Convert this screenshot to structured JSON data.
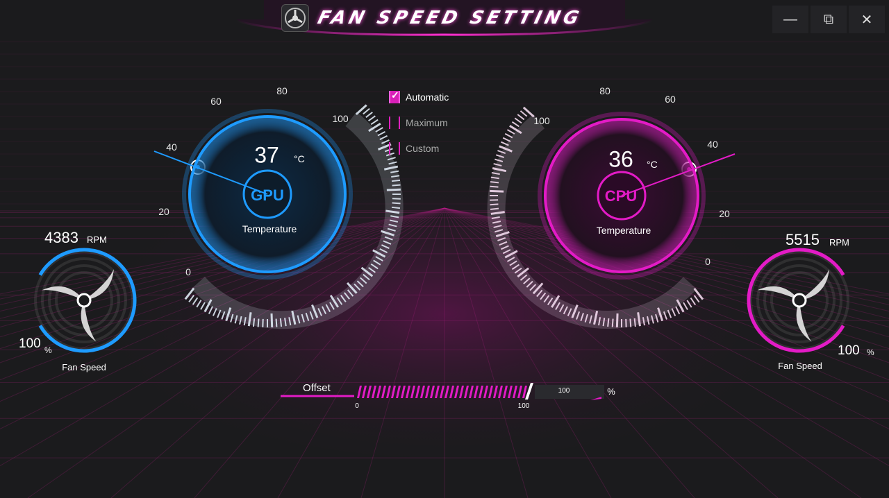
{
  "window": {
    "title": "Fan Speed Setting",
    "icon": "fan-app-icon",
    "controls": {
      "minimize": "—",
      "maximize": "⧉",
      "close": "✕"
    }
  },
  "colors": {
    "gpu_accent": "#1e9bff",
    "cpu_accent": "#e31bc6",
    "background": "#1b1b1d"
  },
  "gpu": {
    "scale_labels": [
      "0",
      "20",
      "40",
      "60",
      "80",
      "100"
    ],
    "temperature": 37,
    "temperature_text": "37",
    "unit": "°C",
    "chip": "GPU",
    "label": "Temperature"
  },
  "cpu": {
    "scale_labels": [
      "0",
      "20",
      "40",
      "60",
      "80",
      "100"
    ],
    "temperature": 36,
    "temperature_text": "36",
    "unit": "°C",
    "chip": "CPU",
    "label": "Temperature"
  },
  "modes": [
    {
      "label": "Automatic",
      "checked": true
    },
    {
      "label": "Maximum",
      "checked": false
    },
    {
      "label": "Custom",
      "checked": false
    }
  ],
  "gpu_fan": {
    "rpm": "4383",
    "rpm_unit": "RPM",
    "speed": "100",
    "speed_unit": "%",
    "label": "Fan Speed",
    "fill_fraction": 1.0,
    "icon": "fan-icon"
  },
  "cpu_fan": {
    "rpm": "5515",
    "rpm_unit": "RPM",
    "speed": "100",
    "speed_unit": "%",
    "label": "Fan Speed",
    "fill_fraction": 1.0,
    "icon": "fan-icon"
  },
  "offset": {
    "label": "Offset",
    "min": "0",
    "max": "100",
    "value_text": "100",
    "unit": "%",
    "fraction": 1.0
  }
}
